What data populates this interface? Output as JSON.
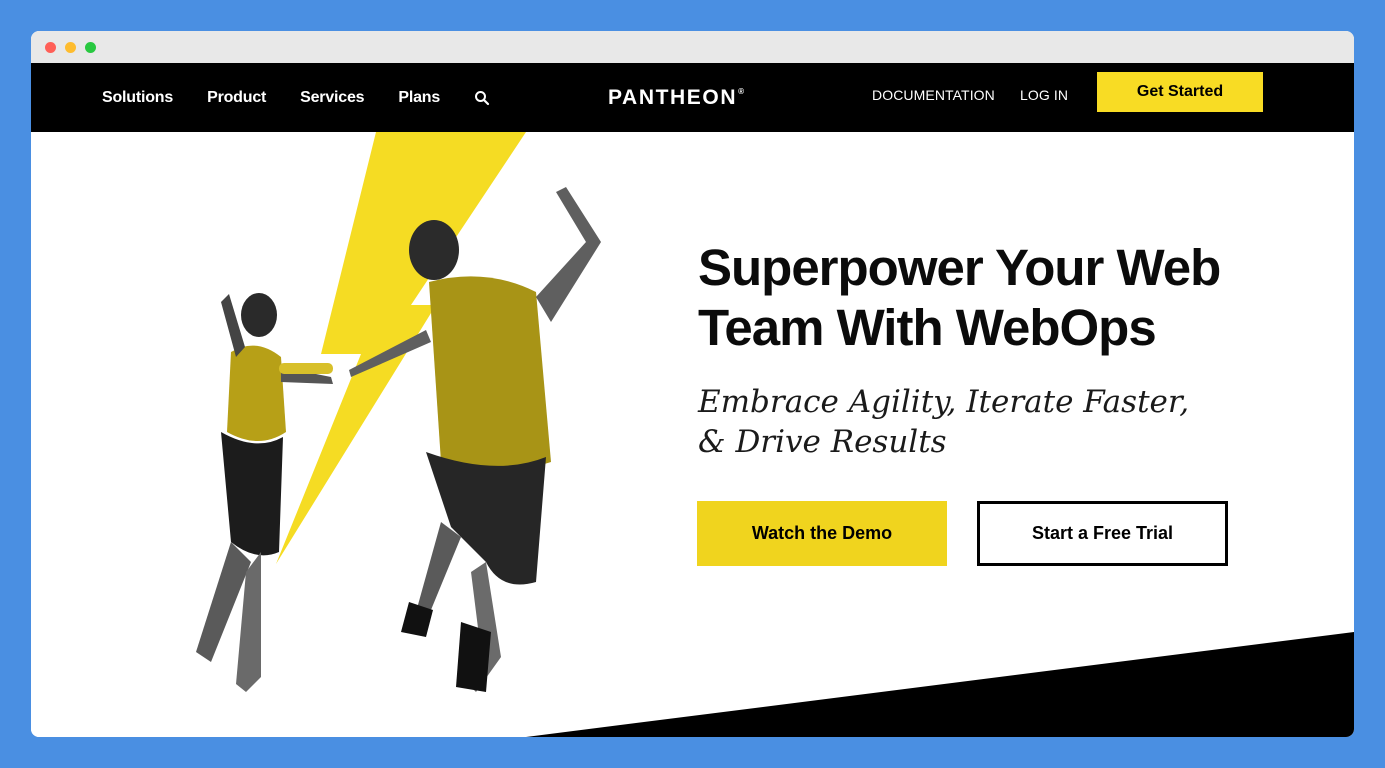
{
  "window": {
    "controls": [
      "close",
      "minimize",
      "zoom"
    ]
  },
  "nav": {
    "items": [
      {
        "label": "Solutions"
      },
      {
        "label": "Product"
      },
      {
        "label": "Services"
      },
      {
        "label": "Plans"
      }
    ],
    "search_icon": "search-icon",
    "logo_text": "PANTHEON",
    "logo_mark": "®",
    "documentation_label": "DOCUMENTATION",
    "login_label": "LOG IN",
    "cta_label": "Get Started"
  },
  "hero": {
    "headline": "Superpower Your Web Team With WebOps",
    "subhead": "Embrace Agility, Iterate Faster, & Drive Results",
    "primary_button": "Watch the Demo",
    "secondary_button": "Start a Free Trial"
  },
  "colors": {
    "brand_yellow": "#f0d41e",
    "nav_background": "#000000",
    "page_background": "#4a8fe2"
  }
}
